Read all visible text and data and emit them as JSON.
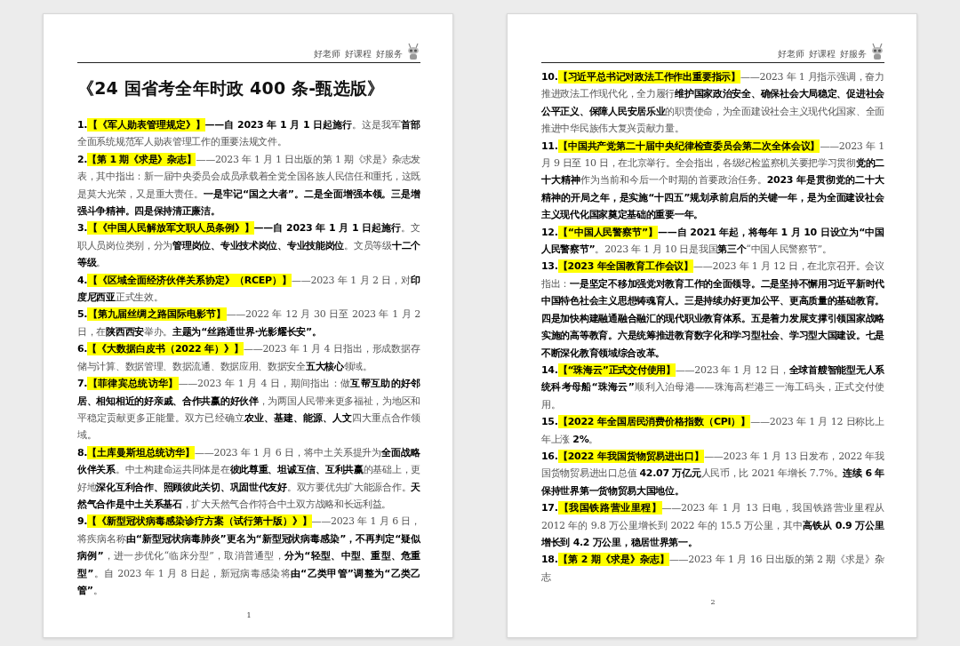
{
  "pages": [
    {
      "header": "好老师 好课程 好服务",
      "title": "《24 国省考全年时政 400 条-甄选版》",
      "page_number": "1",
      "items": [
        {
          "number": "1.",
          "title": "【《军人勋表管理规定》】",
          "body": "**——自 2023 年 1 月 1 日起施行**。这是我军**首部**全面系统规范军人勋表管理工作的重要法规文件。"
        },
        {
          "number": "2.",
          "title": "【第 1 期《求是》杂志】",
          "body": "——2023 年 1 月 1 日出版的第 1 期《求是》杂志发表，其中指出：新一届中央委员会成员承载着全党全国各族人民信任和重托，这既是莫大光荣，又是重大责任。**一是牢记“国之大者”。二是全面增强本领。三是增强斗争精神。四是保持清正廉洁。**"
        },
        {
          "number": "3.",
          "title": "【《中国人民解放军文职人员条例》】",
          "body": "**——自 2023 年 1 月 1 日起施行**。文职人员岗位类别，分为**管理岗位、专业技术岗位、专业技能岗位**。文员等级**十二个等级**。"
        },
        {
          "number": "4.",
          "title": "【《区域全面经济伙伴关系协定》（RCEP）】",
          "body": "——2023 年 1 月 2 日，对**印度尼西亚**正式生效。"
        },
        {
          "number": "5.",
          "title": "【第九届丝绸之路国际电影节】",
          "body": "——2022 年 12 月 30 日至 2023 年 1 月 2 日，在**陕西西安**举办。**主题为“丝路通世界·光影耀长安”。**"
        },
        {
          "number": "6.",
          "title": "【《大数据白皮书（2022 年）》】",
          "body": "——2023 年 1 月 4 日指出，形成数据存储与计算、数据管理、数据流通、数据应用、数据安全**五大核心**领域。"
        },
        {
          "number": "7.",
          "title": "【菲律宾总统访华】",
          "body": "——2023 年 1 月 4 日，期间指出：做**互帮互助的好邻居、相知相近的好亲戚、合作共赢的好伙伴**，为两国人民带来更多福祉，为地区和平稳定贡献更多正能量。双方已经确立**农业、基建、能源、人文**四大重点合作领域。"
        },
        {
          "number": "8.",
          "title": "【土库曼斯坦总统访华】",
          "body": "——2023 年 1 月 6 日，将中土关系提升为**全面战略伙伴关系**。中土构建命运共同体是在**彼此尊重、坦诚互信、互利共赢**的基础上，更好地**深化互利合作、照顾彼此关切、巩固世代友好**。双方要优先扩大能源合作。**天然气合作是中土关系基石**，扩大天然气合作符合中土双方战略和长远利益。"
        },
        {
          "number": "9.",
          "title": "【《新型冠状病毒感染诊疗方案（试行第十版）》】",
          "body": "——2023 年 1 月 6 日，将疾病名称**由“新型冠状病毒肺炎”更名为“新型冠状病毒感染”，不再判定“疑似病例”**，进一步优化“临床分型”，取消普通型，**分为“轻型、中型、重型、危重型”**。自 2023 年 1 月 8 日起，新冠病毒感染将**由“乙类甲管”调整为“乙类乙管”**。"
        }
      ]
    },
    {
      "header": "好老师 好课程 好服务",
      "page_number": "2",
      "items": [
        {
          "number": "10.",
          "title": "【习近平总书记对政法工作作出重要指示】",
          "body": "——2023 年 1 月指示强调，奋力推进政法工作现代化，全力履行**维护国家政治安全、确保社会大局稳定、促进社会公平正义、保障人民安居乐业**的职责使命，为全面建设社会主义现代化国家、全面推进中华民族伟大复兴贡献力量。"
        },
        {
          "number": "11.",
          "title": "【中国共产党第二十届中央纪律检查委员会第二次全体会议】",
          "body": "——2023 年 1 月 9 日至 10 日，在北京举行。全会指出，各级纪检监察机关要把学习贯彻**党的二十大精神**作为当前和今后一个时期的首要政治任务。**2023 年是贯彻党的二十大精神的开局之年，是实施“十四五”规划承前启后的关键一年，是为全面建设社会主义现代化国家奠定基础的重要一年。**"
        },
        {
          "number": "12.",
          "title": "【“中国人民警察节”】",
          "body": "**——自 2021 年起，将每年 1 月 10 日设立为“中国人民警察节”**。2023 年 1 月 10 日是我国**第三个**“中国人民警察节”。"
        },
        {
          "number": "13.",
          "title": "【2023 年全国教育工作会议】",
          "body": "——2023 年 1 月 12 日，在北京召开。会议指出：**一是坚定不移加强党对教育工作的全面领导。二是坚持不懈用习近平新时代中国特色社会主义思想铸魂育人。三是持续办好更加公平、更高质量的基础教育。四是加快构建融通融合融汇的现代职业教育体系。五是着力发展支撑引领国家战略实施的高等教育。六是统筹推进教育数字化和学习型社会、学习型大国建设。七是不断深化教育领域综合改革。**"
        },
        {
          "number": "14.",
          "title": "【“珠海云”正式交付使用】",
          "body": "——2023 年 1 月 12 日，**全球首艘智能型无人系统科考母船“珠海云”**顺利入泊母港——珠海高栏港三一海工码头，正式交付使用。"
        },
        {
          "number": "15.",
          "title": "【2022 年全国居民消费价格指数（CPI）】",
          "body": "——2023 年 1 月 12 日称比上年上涨 **2%**。"
        },
        {
          "number": "16.",
          "title": "【2022 年我国货物贸易进出口】",
          "body": "——2023 年 1 月 13 日发布，2022 年我国货物贸易进出口总值 **42.07 万亿元**人民币，比 2021 年增长 7.7%。**连续 6 年保持世界第一货物贸易大国地位。**"
        },
        {
          "number": "17.",
          "title": "【我国铁路营业里程】",
          "body": "——2023 年 1 月 13 日电，我国铁路营业里程从 2012 年的 9.8 万公里增长到 2022 年的 15.5 万公里，其中**高铁从 0.9 万公里增长到 4.2 万公里，稳居世界第一。**"
        },
        {
          "number": "18.",
          "title": "【第 2 期《求是》杂志】",
          "body": "——2023 年 1 月 16 日出版的第 2 期《求是》杂志"
        }
      ]
    }
  ]
}
